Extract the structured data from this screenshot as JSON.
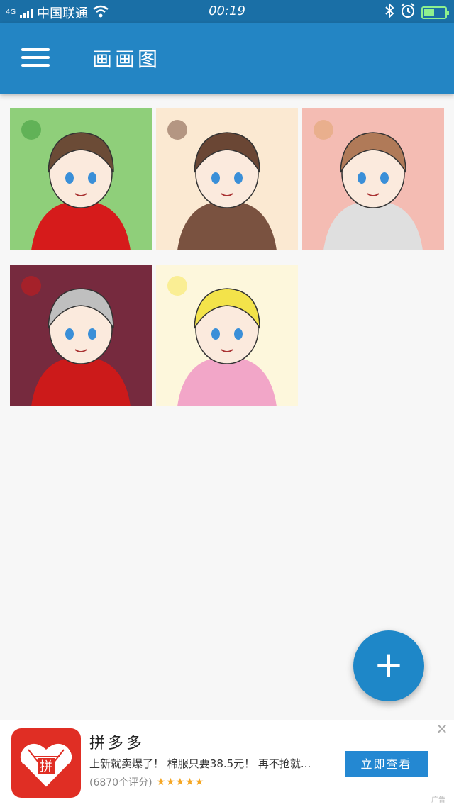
{
  "status_bar": {
    "network": "4G",
    "carrier": "中国联通",
    "time": "00:19"
  },
  "app_bar": {
    "title": "画画图"
  },
  "gallery": {
    "items": [
      {
        "bg": "#8fcf7a",
        "accent": "#3c9b3a",
        "hair": "#6b4b36",
        "cloth": "#d61b1b"
      },
      {
        "bg": "#fbe9d2",
        "accent": "#7a5240",
        "hair": "#6a4634",
        "cloth": "#7a5240"
      },
      {
        "bg": "#f4bcb3",
        "accent": "#e0a46e",
        "hair": "#b07a58",
        "cloth": "#dfdfdf"
      },
      {
        "bg": "#762a3e",
        "accent": "#cc1a1a",
        "hair": "#bfbfbf",
        "cloth": "#cc1a1a"
      },
      {
        "bg": "#fdf7dc",
        "accent": "#f7e85a",
        "hair": "#f3e34a",
        "cloth": "#f2a6c8"
      }
    ]
  },
  "fab": {
    "label": "+"
  },
  "ad": {
    "app_name": "拼多多",
    "description": "上新就卖爆了！ 棉服只要38.5元！ 再不抢就...",
    "rating_text": "(6870个评分)",
    "stars": "★★★★★",
    "cta": "立即查看",
    "close": "✕",
    "mark": "广告",
    "logo_text": "拼"
  },
  "colors": {
    "status_bar": "#1a6fa6",
    "app_bar": "#2385c4",
    "fab": "#1e87c8",
    "ad_cta": "#2488d2",
    "ad_logo": "#e02e24"
  }
}
